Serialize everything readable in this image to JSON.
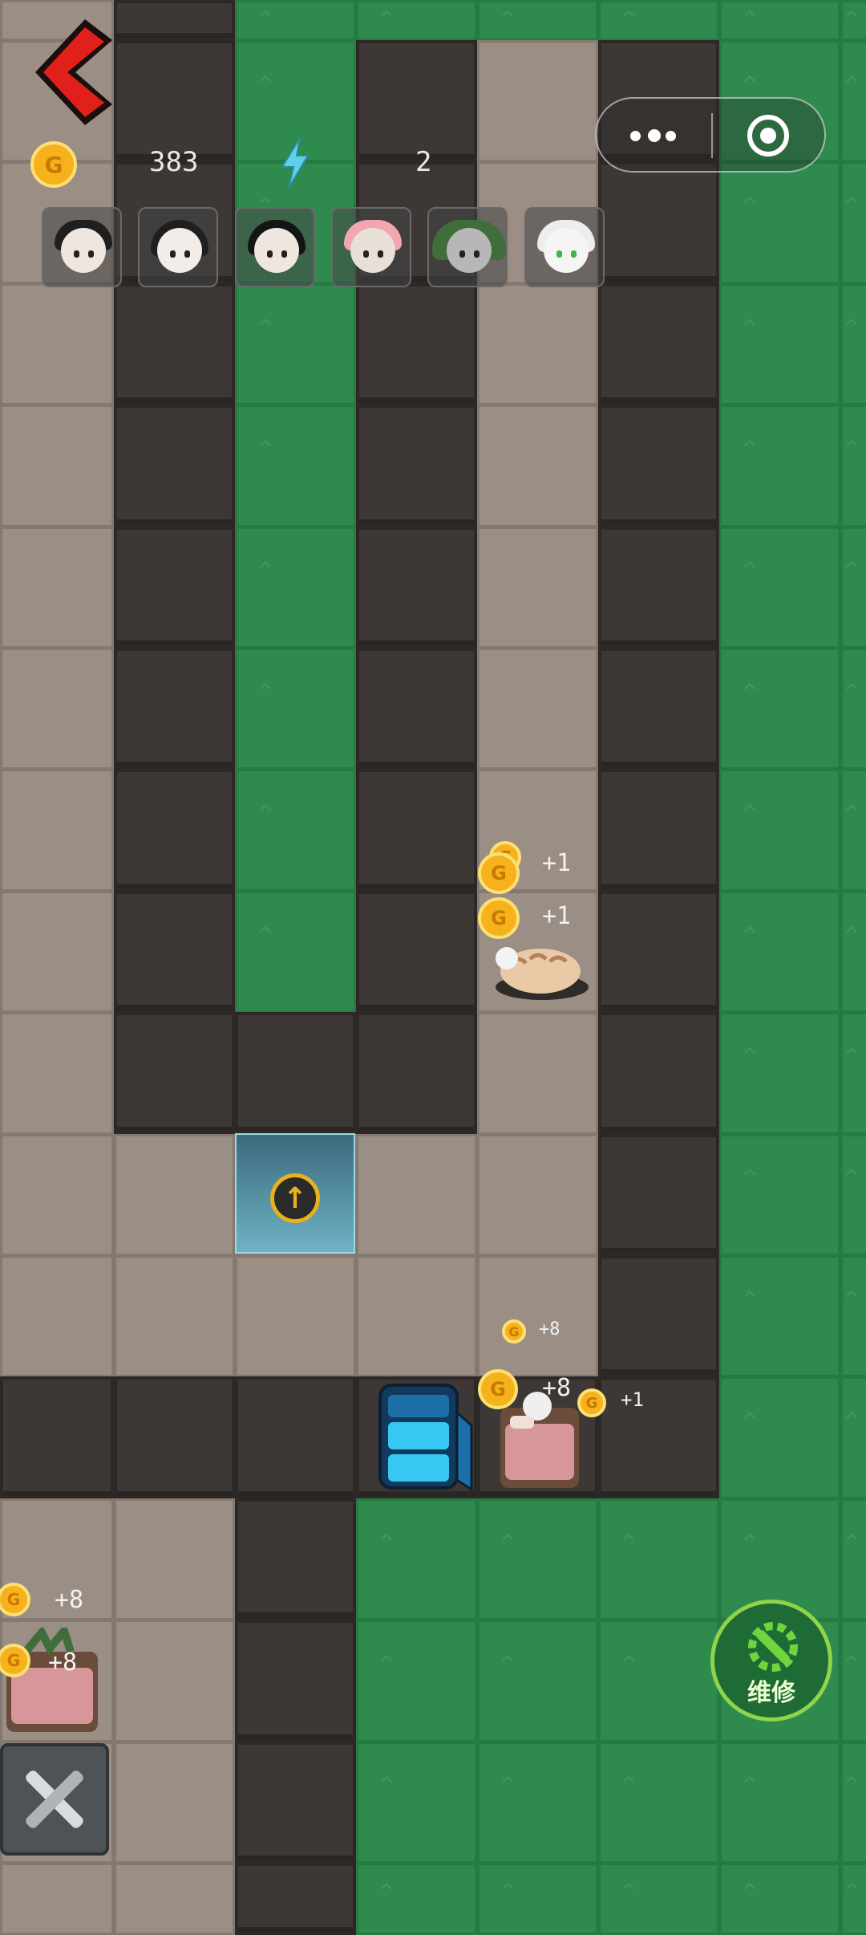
{
  "hud": {
    "gold_count": "383",
    "energy_count": "2",
    "coin_glyph": "G"
  },
  "menu_capsule": {
    "more_icon": "more-dots-icon",
    "close_icon": "target-icon"
  },
  "team": [
    {
      "name": "character-1"
    },
    {
      "name": "character-2"
    },
    {
      "name": "character-3"
    },
    {
      "name": "character-4"
    },
    {
      "name": "character-5"
    },
    {
      "name": "character-6"
    }
  ],
  "floating_rewards": {
    "plus_one": "+1",
    "plus_eight": "+8"
  },
  "actions": {
    "repair_label": "维修",
    "upgrade_icon": "arrow-up-icon"
  },
  "colors": {
    "grass": "#2f8a4e",
    "floor": "#9b8e85",
    "wall": "#3d3835",
    "back_arrow": "#e1201b",
    "coin": "#f6b21d",
    "repair_ring": "#8fd44a"
  }
}
